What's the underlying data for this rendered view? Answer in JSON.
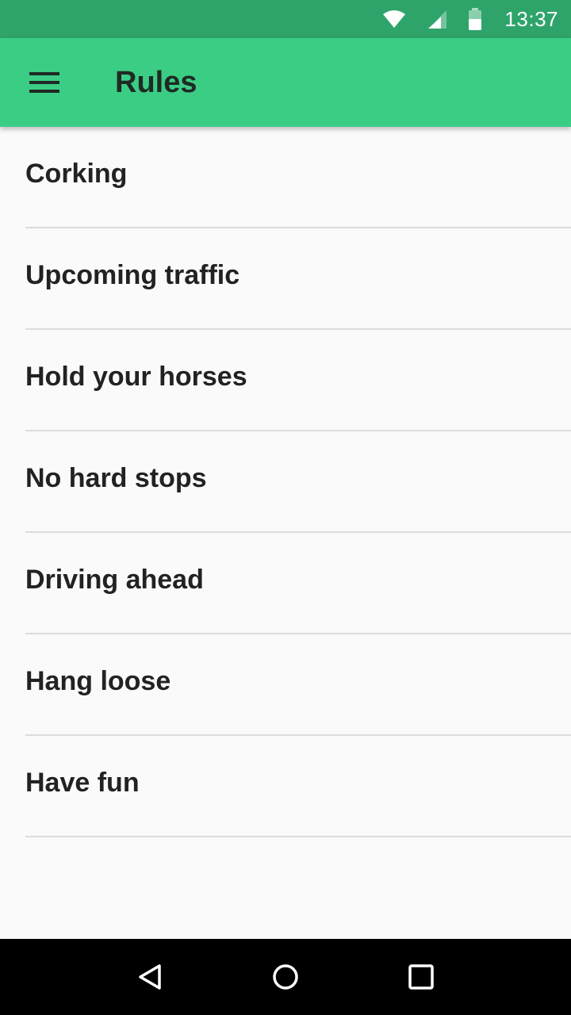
{
  "status_bar": {
    "time": "13:37",
    "icons": [
      "wifi-icon",
      "cell-signal-icon",
      "battery-icon"
    ]
  },
  "app_bar": {
    "menu_icon": "hamburger-menu-icon",
    "title": "Rules",
    "background_color": "#3ccd85",
    "status_color": "#2ea46b"
  },
  "rules": [
    {
      "label": "Corking"
    },
    {
      "label": "Upcoming traffic"
    },
    {
      "label": "Hold your horses"
    },
    {
      "label": "No hard stops"
    },
    {
      "label": "Driving ahead"
    },
    {
      "label": "Hang loose"
    },
    {
      "label": "Have fun"
    }
  ],
  "nav_bar": {
    "buttons": [
      "back-icon",
      "home-icon",
      "recents-icon"
    ]
  }
}
